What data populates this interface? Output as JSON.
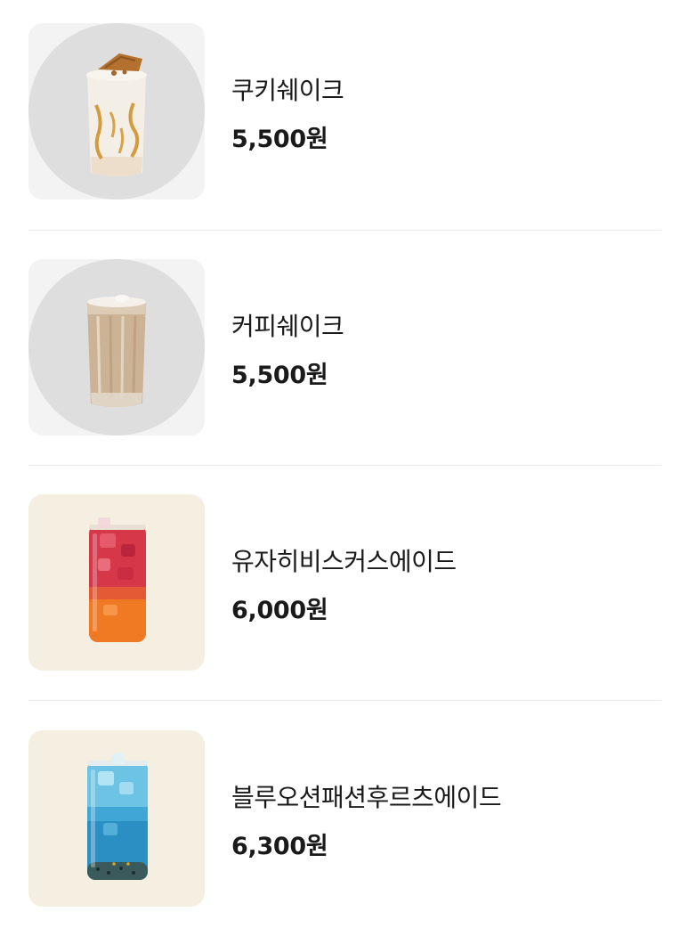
{
  "menu": {
    "items": [
      {
        "name": "쿠키쉐이크",
        "price": "5,500원",
        "image": "cookie-shake-photo"
      },
      {
        "name": "커피쉐이크",
        "price": "5,500원",
        "image": "coffee-shake-photo"
      },
      {
        "name": "유자히비스커스에이드",
        "price": "6,000원",
        "image": "yuja-hibiscus-ade-photo"
      },
      {
        "name": "블루오션패션후르츠에이드",
        "price": "6,300원",
        "image": "blue-ocean-passionfruit-ade-photo"
      }
    ]
  },
  "colors": {
    "shake_bg": "#f3f3f3",
    "shake_circle": "#dedede",
    "ade_bg": "#f5efe1",
    "divider": "#ececec"
  }
}
